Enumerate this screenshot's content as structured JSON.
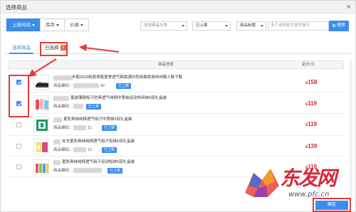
{
  "dialog": {
    "title": "选择商品",
    "close": "×"
  },
  "filters": {
    "sort_buttons": [
      {
        "label": "上架时间",
        "active": true
      },
      {
        "label": "库存",
        "active": false
      },
      {
        "label": "价格",
        "active": false
      }
    ],
    "category_select": "全部商品分类",
    "status_select": "已上架",
    "field_select": "商品标题",
    "search_placeholder": "多个请用英文逗号隔开",
    "search_button": "搜索"
  },
  "tabs": [
    {
      "label": "选择商品",
      "active": true
    },
    {
      "label": "已选择",
      "badge": "2"
    }
  ],
  "table": {
    "header_info": "商品信息",
    "header_price": "定价/元",
    "code_label": "商品编码：",
    "rows": [
      {
        "checked": true,
        "name": "步鞋2018新款男鞋夏季透气韩版潮白色网面旅游休闲懒人鞋子鞋",
        "code_tail": "42",
        "tag": "已上架",
        "price_symbol": "¥",
        "price": "158"
      },
      {
        "checked": true,
        "name": "夏装薄款吸汗防臭透气纯棉中筒袜运动休闲袜6双礼盒装",
        "code_tail": "",
        "tag": "已上架",
        "price_symbol": "¥",
        "price": "119"
      },
      {
        "checked": false,
        "name": "夏防臭袜纯棉透气吸汗中筒袜6双礼盒装",
        "code_tail": "11",
        "tag": "已上架",
        "price_symbol": "¥",
        "price": "119"
      },
      {
        "checked": false,
        "name": "女夫夏防臭袜纯棉透气吸汗短袜6双礼盒装",
        "code_tail": "12",
        "tag": "已上架",
        "price_symbol": "¥",
        "price": "139"
      },
      {
        "checked": false,
        "name": "夏防臭袜纯棉透气吸汗运动短袜5双礼盒装",
        "code_tail": "",
        "tag": "已上架",
        "price_symbol": "¥",
        "price": "119"
      }
    ]
  },
  "footer": {
    "confirm": "确定"
  },
  "watermark": {
    "brand": "东发网",
    "url": "www.pfc.cn"
  },
  "colors": {
    "accent": "#3b8ded",
    "price": "#e0242a",
    "annotation": "#e33a3a",
    "badge": "#f16b2b"
  }
}
